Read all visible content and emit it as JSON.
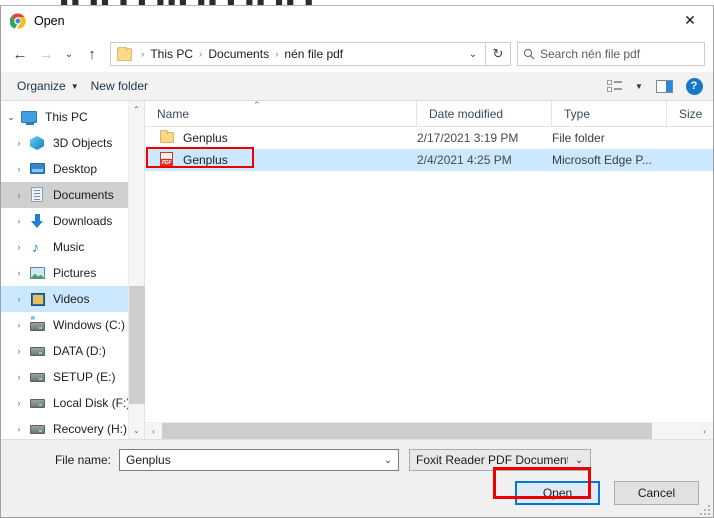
{
  "background_bleed": "▮▮ ▮▮ ▮ ▮ ▮▮▮ ▮▮ ▮ ▮▮ ▮▮ ▮",
  "window": {
    "title": "Open",
    "title_icon": "chrome-icon",
    "close_label": "✕"
  },
  "nav": {
    "back": "←",
    "forward": "→",
    "recent": "⌄",
    "up": "↑",
    "refresh": "↻",
    "breadcrumb": [
      "This PC",
      "Documents",
      "nén file pdf"
    ],
    "separator": "›",
    "dropdown": "⌄"
  },
  "search": {
    "placeholder": "Search nén file pdf",
    "icon": "search-icon"
  },
  "toolbar": {
    "organize": "Organize",
    "new_folder": "New folder",
    "caret": "▼",
    "view_icon": "view-options-icon",
    "preview_icon": "preview-pane-icon",
    "help_icon": "help-icon",
    "help_glyph": "?"
  },
  "sidebar": {
    "items": [
      {
        "label": "This PC",
        "icon": "computer-icon",
        "chev": "⌄",
        "level": 1,
        "state": "none"
      },
      {
        "label": "3D Objects",
        "icon": "3d-objects-icon",
        "chev": "›",
        "level": 2,
        "state": "none"
      },
      {
        "label": "Desktop",
        "icon": "desktop-icon",
        "chev": "›",
        "level": 2,
        "state": "none"
      },
      {
        "label": "Documents",
        "icon": "documents-icon",
        "chev": "›",
        "level": 2,
        "state": "selected"
      },
      {
        "label": "Downloads",
        "icon": "downloads-icon",
        "chev": "›",
        "level": 2,
        "state": "none"
      },
      {
        "label": "Music",
        "icon": "music-icon",
        "chev": "›",
        "level": 2,
        "state": "none"
      },
      {
        "label": "Pictures",
        "icon": "pictures-icon",
        "chev": "›",
        "level": 2,
        "state": "none"
      },
      {
        "label": "Videos",
        "icon": "videos-icon",
        "chev": "›",
        "level": 2,
        "state": "hover"
      },
      {
        "label": "Windows (C:)",
        "icon": "windows-drive-icon",
        "chev": "›",
        "level": 2,
        "state": "none"
      },
      {
        "label": "DATA (D:)",
        "icon": "drive-icon",
        "chev": "›",
        "level": 2,
        "state": "none"
      },
      {
        "label": "SETUP (E:)",
        "icon": "drive-icon",
        "chev": "›",
        "level": 2,
        "state": "none"
      },
      {
        "label": "Local Disk (F:)",
        "icon": "drive-icon",
        "chev": "›",
        "level": 2,
        "state": "none"
      },
      {
        "label": "Recovery (H:)",
        "icon": "drive-icon",
        "chev": "›",
        "level": 2,
        "state": "none"
      }
    ],
    "scroll_up": "⌃",
    "scroll_down": "⌄"
  },
  "filelist": {
    "columns": [
      "Name",
      "Date modified",
      "Type",
      "Size"
    ],
    "sort_indicator": "⌃",
    "rows": [
      {
        "name": "Genplus",
        "icon": "folder-icon",
        "date": "2/17/2021 3:19 PM",
        "type": "File folder",
        "size": "",
        "selected": false,
        "annotated": false
      },
      {
        "name": "Genplus",
        "icon": "pdf-file-icon",
        "date": "2/4/2021 4:25 PM",
        "type": "Microsoft Edge P...",
        "size": "",
        "selected": true,
        "annotated": true
      }
    ],
    "pdf_badge": "PDF",
    "hscroll_left": "‹",
    "hscroll_right": "›"
  },
  "footer": {
    "filename_label": "File name:",
    "filename_value": "Genplus",
    "filename_caret": "⌄",
    "filetype_value": "Foxit Reader PDF Document",
    "filetype_caret": "⌄",
    "open_label": "Open",
    "cancel_label": "Cancel"
  },
  "colors": {
    "selection_blue": "#cce8ff",
    "annotation_red": "#ee0000",
    "focus_blue": "#0078d7",
    "accent_blue": "#1878c8",
    "folder_yellow": "#fcd88b"
  }
}
